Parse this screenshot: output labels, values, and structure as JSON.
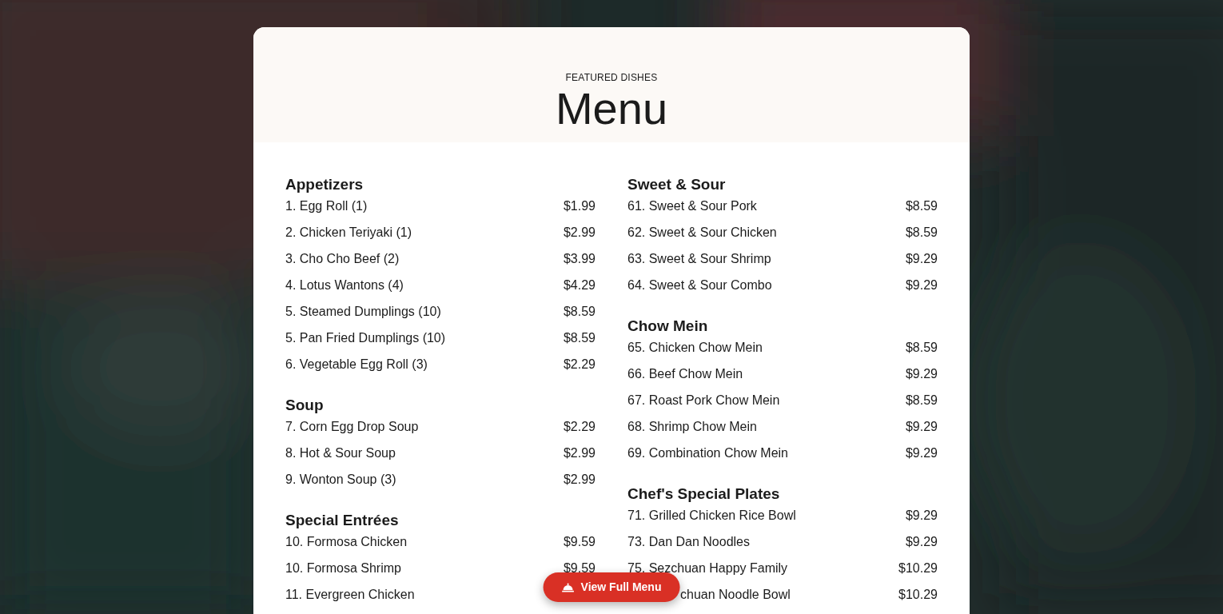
{
  "header": {
    "eyebrow": "FEATURED DISHES",
    "title": "Menu"
  },
  "columns": [
    [
      {
        "title": "Appetizers",
        "items": [
          {
            "name": "1. Egg Roll (1)",
            "price": "$1.99"
          },
          {
            "name": "2. Chicken Teriyaki (1)",
            "price": "$2.99"
          },
          {
            "name": "3. Cho Cho Beef (2)",
            "price": "$3.99"
          },
          {
            "name": "4. Lotus Wantons (4)",
            "price": "$4.29"
          },
          {
            "name": "5. Steamed Dumplings (10)",
            "price": "$8.59"
          },
          {
            "name": "5. Pan Fried Dumplings (10)",
            "price": "$8.59"
          },
          {
            "name": "6. Vegetable Egg Roll (3)",
            "price": "$2.29"
          }
        ]
      },
      {
        "title": "Soup",
        "items": [
          {
            "name": "7. Corn Egg Drop Soup",
            "price": "$2.29"
          },
          {
            "name": "8. Hot & Sour Soup",
            "price": "$2.99"
          },
          {
            "name": "9. Wonton Soup (3)",
            "price": "$2.99"
          }
        ]
      },
      {
        "title": "Special Entrées",
        "items": [
          {
            "name": "10. Formosa Chicken",
            "price": "$9.59"
          },
          {
            "name": "10. Formosa Shrimp",
            "price": "$9.59"
          },
          {
            "name": "11. Evergreen Chicken",
            "covered": true
          }
        ]
      }
    ],
    [
      {
        "title": "Sweet & Sour",
        "items": [
          {
            "name": "61. Sweet & Sour Pork",
            "price": "$8.59"
          },
          {
            "name": "62. Sweet & Sour Chicken",
            "price": "$8.59"
          },
          {
            "name": "63. Sweet & Sour Shrimp",
            "price": "$9.29"
          },
          {
            "name": "64. Sweet & Sour Combo",
            "price": "$9.29"
          }
        ]
      },
      {
        "title": "Chow Mein",
        "items": [
          {
            "name": "65. Chicken Chow Mein",
            "price": "$8.59"
          },
          {
            "name": "66. Beef Chow Mein",
            "price": "$9.29"
          },
          {
            "name": "67. Roast Pork Chow Mein",
            "price": "$8.59"
          },
          {
            "name": "68. Shrimp Chow Mein",
            "price": "$9.29"
          },
          {
            "name": "69. Combination Chow Mein",
            "price": "$9.29"
          }
        ]
      },
      {
        "title": "Chef's Special Plates",
        "items": [
          {
            "name": "71. Grilled Chicken Rice Bowl",
            "price": "$9.29"
          },
          {
            "name": "73. Dan Dan Noodles",
            "price": "$9.29"
          },
          {
            "name": "75. Sezchuan Happy Family",
            "price": "$10.29"
          },
          {
            "name": "chuan Noodle Bowl",
            "price": "$10.29",
            "covered": true
          }
        ]
      }
    ]
  ],
  "button": {
    "label": "View Full Menu"
  }
}
